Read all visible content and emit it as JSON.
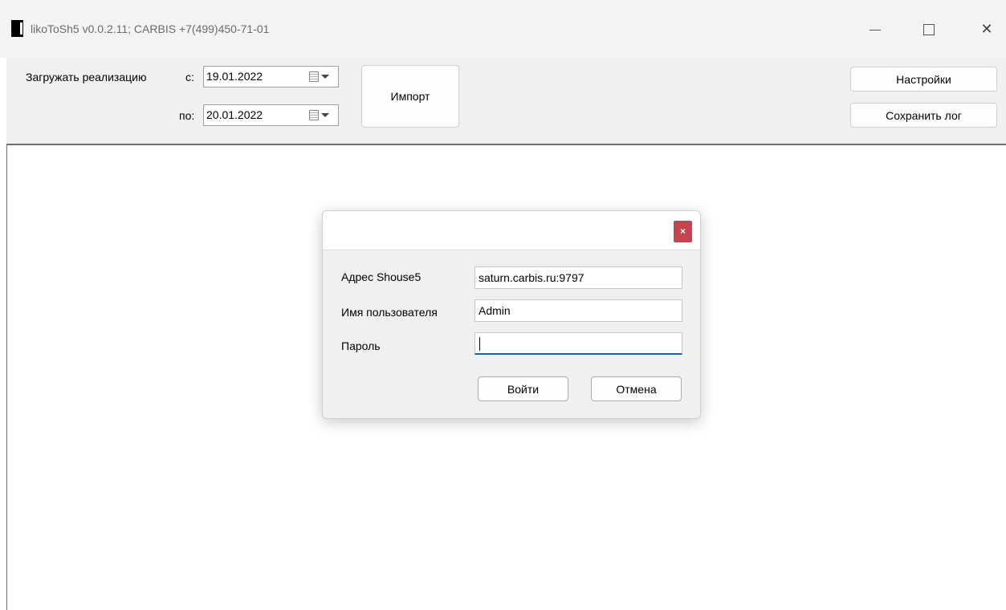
{
  "window": {
    "title": "likoToSh5 v0.0.2.11;  CARBIS +7(499)450-71-01"
  },
  "toolbar": {
    "load_label": "Загружать реализацию",
    "from_label": "с:",
    "to_label": "по:",
    "from_date": "19.01.2022",
    "to_date": "20.01.2022",
    "import_label": "Импорт",
    "settings_label": "Настройки",
    "save_log_label": "Сохранить лог"
  },
  "dialog": {
    "close_glyph": "×",
    "address_label": "Адрес Shouse5",
    "address_value": "saturn.carbis.ru:9797",
    "user_label": "Имя пользователя",
    "user_value": "Admin",
    "password_label": "Пароль",
    "password_value": "",
    "login_label": "Войти",
    "cancel_label": "Отмена"
  },
  "icons": {
    "app": "app-icon",
    "minimize": "minimize-icon",
    "maximize": "maximize-icon",
    "close": "close-icon",
    "calendar": "calendar-icon"
  },
  "colors": {
    "dialog_close": "#c9434a",
    "focus_underline": "#1f5fa6"
  }
}
